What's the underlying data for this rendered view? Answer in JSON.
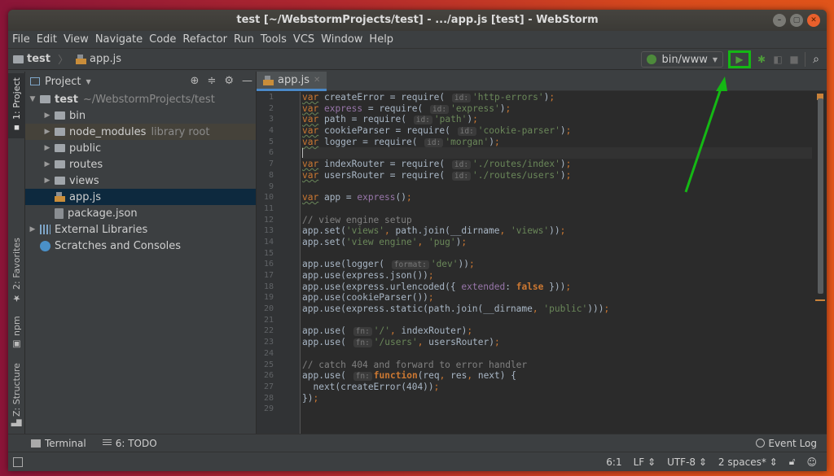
{
  "window": {
    "title": "test [~/WebstormProjects/test] - .../app.js [test] - WebStorm",
    "controls": [
      "minimize",
      "maximize",
      "close"
    ]
  },
  "menu": [
    "File",
    "Edit",
    "View",
    "Navigate",
    "Code",
    "Refactor",
    "Run",
    "Tools",
    "VCS",
    "Window",
    "Help"
  ],
  "navbar": {
    "crumbs": [
      "test",
      "app.js"
    ],
    "run_config": "bin/www",
    "run_label": "Run",
    "debug_label": "Debug",
    "coverage_label": "Run with Coverage",
    "stop_label": "Stop",
    "search_label": "Search Everywhere"
  },
  "left_strip": {
    "tabs": [
      "1: Project",
      "2: Favorites",
      "npm",
      "Z: Structure"
    ]
  },
  "project": {
    "title": "Project",
    "tree": [
      {
        "name": "test",
        "extra": "~/WebstormProjects/test",
        "type": "folder",
        "depth": 0,
        "expanded": true
      },
      {
        "name": "bin",
        "extra": "",
        "type": "folder",
        "depth": 1
      },
      {
        "name": "node_modules",
        "extra": "library root",
        "type": "folder",
        "depth": 1
      },
      {
        "name": "public",
        "extra": "",
        "type": "folder",
        "depth": 1
      },
      {
        "name": "routes",
        "extra": "",
        "type": "folder",
        "depth": 1
      },
      {
        "name": "views",
        "extra": "",
        "type": "folder",
        "depth": 1
      },
      {
        "name": "app.js",
        "extra": "",
        "type": "js",
        "depth": 1,
        "selected": true
      },
      {
        "name": "package.json",
        "extra": "",
        "type": "json",
        "depth": 1
      },
      {
        "name": "External Libraries",
        "extra": "",
        "type": "extlib",
        "depth": 0
      },
      {
        "name": "Scratches and Consoles",
        "extra": "",
        "type": "scratch",
        "depth": 0
      }
    ]
  },
  "editor": {
    "tab": "app.js",
    "current_line": 6,
    "lines": [
      "var createError = require( id: 'http-errors');",
      "var express = require( id: 'express');",
      "var path = require( id: 'path');",
      "var cookieParser = require( id: 'cookie-parser');",
      "var logger = require( id: 'morgan');",
      "",
      "var indexRouter = require( id: './routes/index');",
      "var usersRouter = require( id: './routes/users');",
      "",
      "var app = express();",
      "",
      "// view engine setup",
      "app.set('views', path.join(__dirname, 'views'));",
      "app.set('view engine', 'pug');",
      "",
      "app.use(logger( format: 'dev'));",
      "app.use(express.json());",
      "app.use(express.urlencoded({ extended: false }));",
      "app.use(cookieParser());",
      "app.use(express.static(path.join(__dirname, 'public')));",
      "",
      "app.use( fn: '/', indexRouter);",
      "app.use( fn: '/users', usersRouter);",
      "",
      "// catch 404 and forward to error handler",
      "app.use( fn: function(req, res, next) {",
      "  next(createError(404));",
      "});",
      ""
    ]
  },
  "bottom_tools": {
    "terminal": "Terminal",
    "todo": "6: TODO",
    "event_log": "Event Log"
  },
  "status": {
    "position": "6:1",
    "line_sep": "LF",
    "encoding": "UTF-8",
    "indent": "2 spaces*"
  },
  "annotation": {
    "color": "#14b814",
    "target": "run-button"
  }
}
